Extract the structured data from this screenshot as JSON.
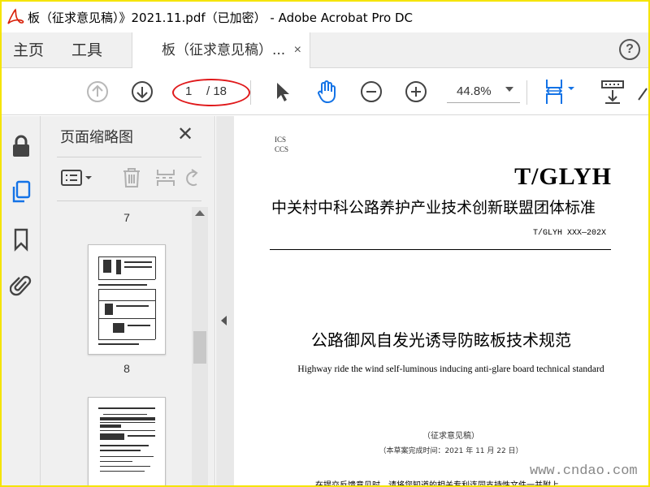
{
  "window": {
    "title": "板（征求意见稿）》2021.11.pdf（已加密） - Adobe Acrobat Pro DC"
  },
  "nav": {
    "home": "主页",
    "tools": "工具"
  },
  "doc_tab": {
    "label": "板（征求意见稿）...",
    "close": "×"
  },
  "help": "?",
  "toolbar": {
    "page_current": "1",
    "page_total": "/ 18",
    "zoom": "44.8%"
  },
  "thumbnail_panel": {
    "title": "页面缩略图",
    "close": "✕",
    "pages": [
      "7",
      "8"
    ]
  },
  "document": {
    "ics": "ICS",
    "ccs": "CCS",
    "org_code": "T/GLYH",
    "alliance": "中关村中科公路养护产业技术创新联盟团体标准",
    "std_code": "T/GLYH XXX—202X",
    "title_cn": "公路御风自发光诱导防眩板技术规范",
    "title_en": "Highway ride the wind self-luminous inducing anti-glare board technical standard",
    "status": "（征求意见稿）",
    "date": "（本草案完成时间：2021 年 11 月 22 日）",
    "notice": "在提交反馈意见时，请将您知道的相关专利连同支持性文件一并附上。"
  },
  "watermark": "www.cndao.com",
  "colors": {
    "acrobat_blue": "#1473e6",
    "annotation_red": "#e0191b",
    "frame_yellow": "#f5e400"
  }
}
